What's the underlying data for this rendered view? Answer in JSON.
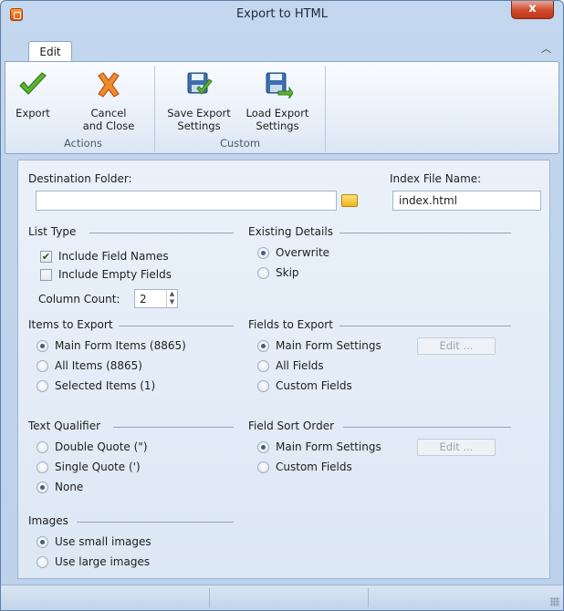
{
  "window": {
    "title": "Export to HTML",
    "close_label": "x"
  },
  "ribbon": {
    "tab_label": "Edit",
    "groups": [
      {
        "label": "Actions",
        "buttons": [
          {
            "line1": "Export",
            "line2": ""
          },
          {
            "line1": "Cancel",
            "line2": "and Close"
          }
        ]
      },
      {
        "label": "Custom",
        "buttons": [
          {
            "line1": "Save Export",
            "line2": "Settings"
          },
          {
            "line1": "Load Export",
            "line2": "Settings"
          }
        ]
      }
    ]
  },
  "form": {
    "destination_folder": {
      "label": "Destination Folder:",
      "value": ""
    },
    "index_file": {
      "label": "Index File Name:",
      "value": "index.html"
    },
    "list_type": {
      "header": "List Type",
      "include_field_names": {
        "label": "Include Field Names",
        "checked": true
      },
      "include_empty_fields": {
        "label": "Include Empty Fields",
        "checked": false
      },
      "column_count": {
        "label": "Column Count:",
        "value": "2"
      }
    },
    "existing_details": {
      "header": "Existing Details",
      "options": [
        "Overwrite",
        "Skip"
      ],
      "selected": 0
    },
    "items_to_export": {
      "header": "Items to Export",
      "options": [
        "Main Form Items (8865)",
        "All Items (8865)",
        "Selected Items (1)"
      ],
      "selected": 0
    },
    "fields_to_export": {
      "header": "Fields to Export",
      "options": [
        "Main Form Settings",
        "All Fields",
        "Custom Fields"
      ],
      "selected": 0,
      "edit_label": "Edit ..."
    },
    "text_qualifier": {
      "header": "Text Qualifier",
      "options": [
        "Double Quote (\")",
        "Single Quote (')",
        "None"
      ],
      "selected": 2
    },
    "field_sort_order": {
      "header": "Field Sort Order",
      "options": [
        "Main Form Settings",
        "Custom Fields"
      ],
      "selected": 0,
      "edit_label": "Edit ..."
    },
    "images": {
      "header": "Images",
      "options": [
        "Use small images",
        "Use large images"
      ],
      "selected": 0
    }
  }
}
